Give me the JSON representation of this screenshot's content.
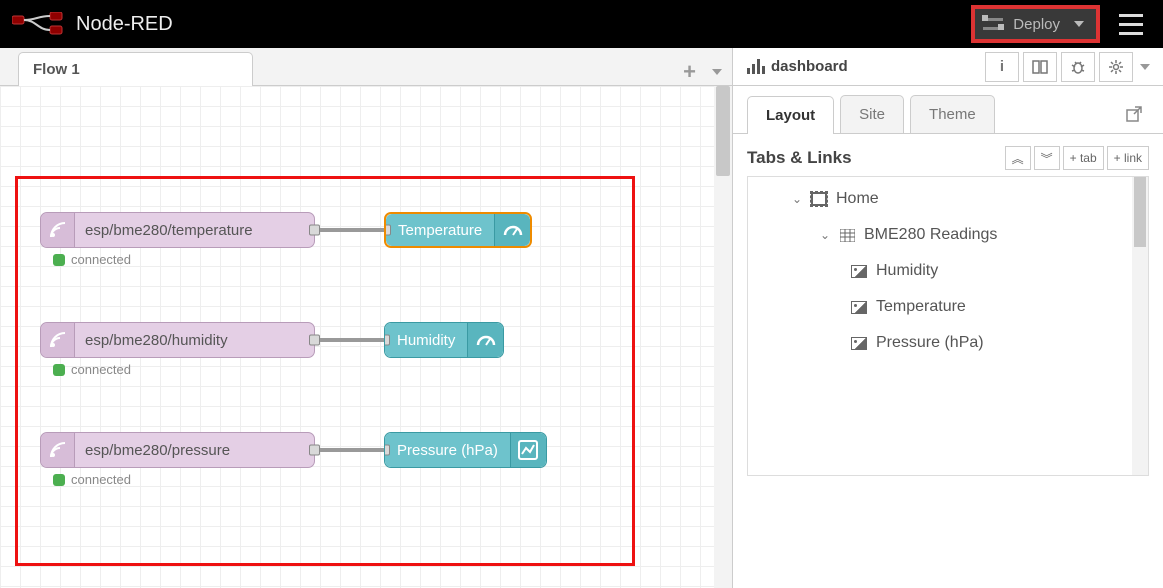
{
  "header": {
    "app_title": "Node-RED",
    "deploy_label": "Deploy"
  },
  "workspace": {
    "tabs": [
      {
        "label": "Flow 1"
      }
    ],
    "nodes": {
      "mqtt1": {
        "label": "esp/bme280/temperature",
        "status": "connected"
      },
      "mqtt2": {
        "label": "esp/bme280/humidity",
        "status": "connected"
      },
      "mqtt3": {
        "label": "esp/bme280/pressure",
        "status": "connected"
      },
      "dash1": {
        "label": "Temperature"
      },
      "dash2": {
        "label": "Humidity"
      },
      "dash3": {
        "label": "Pressure (hPa)"
      }
    }
  },
  "sidebar": {
    "title": "dashboard",
    "tabs": {
      "layout": "Layout",
      "site": "Site",
      "theme": "Theme"
    },
    "section_title": "Tabs & Links",
    "buttons": {
      "expand": "︽",
      "collapse": "︾",
      "add_tab": "+ tab",
      "add_link": "+ link"
    },
    "tree": {
      "home": "Home",
      "group": "BME280 Readings",
      "widgets": [
        "Humidity",
        "Temperature",
        "Pressure (hPa)"
      ]
    }
  }
}
